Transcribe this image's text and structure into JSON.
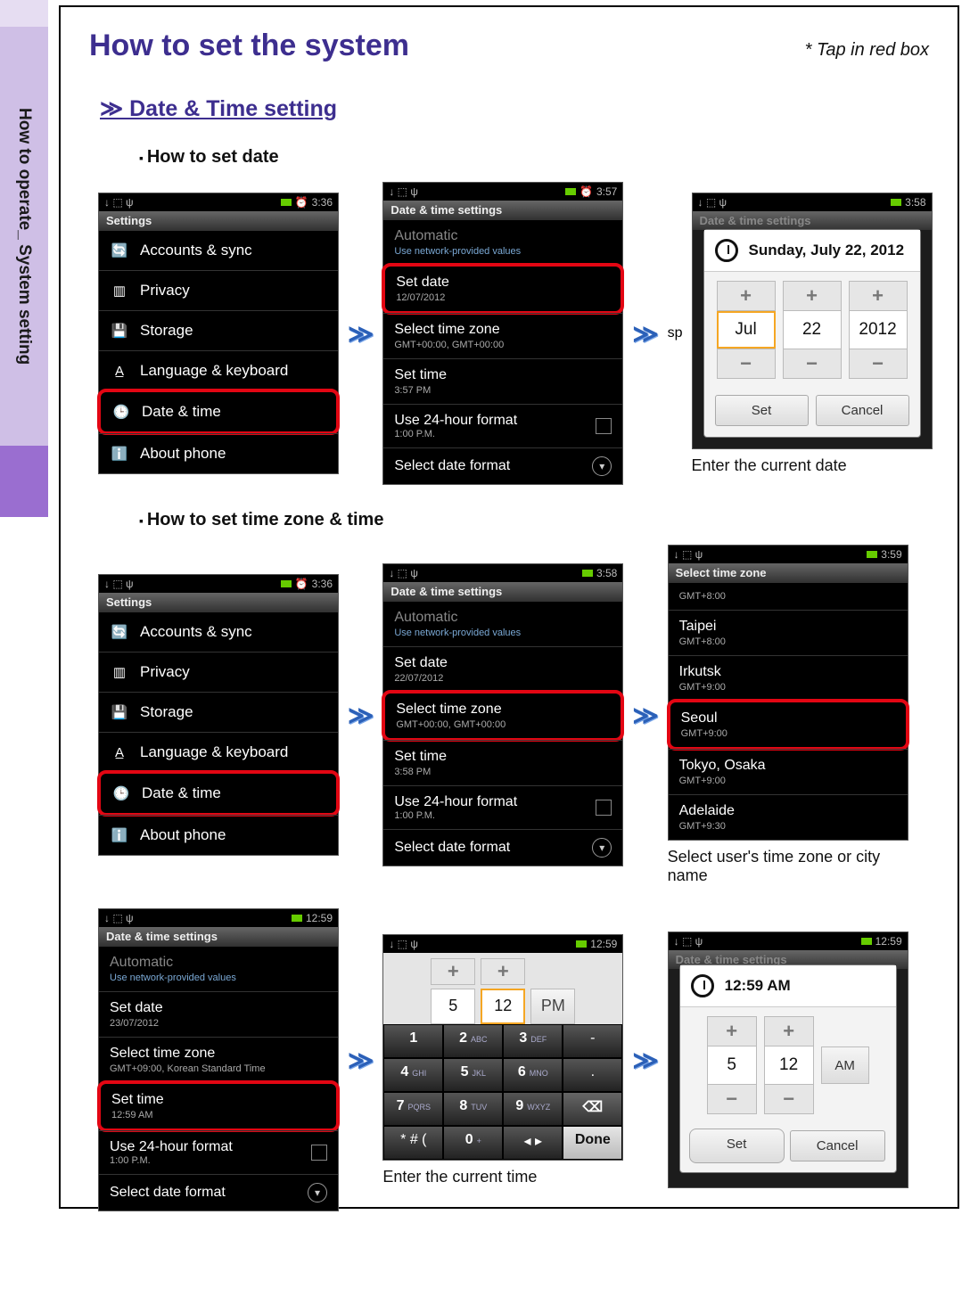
{
  "side_label": "How to operate_ System setting",
  "title": "How to set the system",
  "tap_note": "* Tap in red box",
  "section1": "≫ Date & Time setting",
  "bullet_date": "How to set date",
  "bullet_time": "How to set time zone & time",
  "caption_date": "Enter the current date",
  "caption_zone": "Select user's time zone or city name",
  "caption_time": "Enter the current time",
  "times": {
    "t336": "3:36",
    "t357": "3:57",
    "t358": "3:58",
    "t359": "3:59",
    "t1259": "12:59"
  },
  "settings_hdr": "Settings",
  "dt_hdr": "Date & time settings",
  "tz_hdr": "Select time zone",
  "menu": {
    "accounts": "Accounts & sync",
    "privacy": "Privacy",
    "storage": "Storage",
    "lang": "Language & keyboard",
    "datetime": "Date & time",
    "about": "About phone"
  },
  "dt": {
    "auto": "Automatic",
    "auto_sub": "Use network-provided values",
    "setdate": "Set date",
    "setdate_sub1": "12/07/2012",
    "setdate_sub2": "22/07/2012",
    "setdate_sub3": "23/07/2012",
    "tz": "Select time zone",
    "tz_sub": "GMT+00:00, GMT+00:00",
    "tz_sub_kr": "GMT+09:00, Korean Standard Time",
    "settime": "Set time",
    "settime_sub1": "3:57 PM",
    "settime_sub2": "3:58 PM",
    "settime_sub3": "12:59 AM",
    "h24": "Use 24-hour format",
    "h24_sub": "1:00 P.M.",
    "fmt": "Select date format"
  },
  "date_dialog": {
    "header": "Sunday, July 22, 2012",
    "month": "Jul",
    "day": "22",
    "year": "2012",
    "set": "Set",
    "cancel": "Cancel"
  },
  "zones": {
    "gmt8": "GMT+8:00",
    "taipei": "Taipei",
    "taipei_sub": "GMT+8:00",
    "irkutsk": "Irkutsk",
    "irkutsk_sub": "GMT+9:00",
    "seoul": "Seoul",
    "seoul_sub": "GMT+9:00",
    "tokyo": "Tokyo, Osaka",
    "tokyo_sub": "GMT+9:00",
    "adelaide": "Adelaide",
    "adelaide_sub": "GMT+9:30"
  },
  "time_dialog": {
    "header": "12:59 AM",
    "h": "5",
    "m": "12",
    "ampm_pm": "PM",
    "ampm_am": "AM",
    "set": "Set",
    "cancel": "Cancel"
  },
  "keys": {
    "1": "1",
    "2": "2",
    "2s": "ABC",
    "3": "3",
    "3s": "DEF",
    "4": "4",
    "4s": "GHI",
    "5": "5",
    "5s": "JKL",
    "6": "6",
    "6s": "MNO",
    "7": "7",
    "7s": "PQRS",
    "8": "8",
    "8s": "TUV",
    "9": "9",
    "9s": "WXYZ",
    "0": "0",
    "sym": "* # (",
    "plus": "+",
    "done": "Done",
    "dash": "-",
    "dot": ".",
    "del": "⌫"
  }
}
